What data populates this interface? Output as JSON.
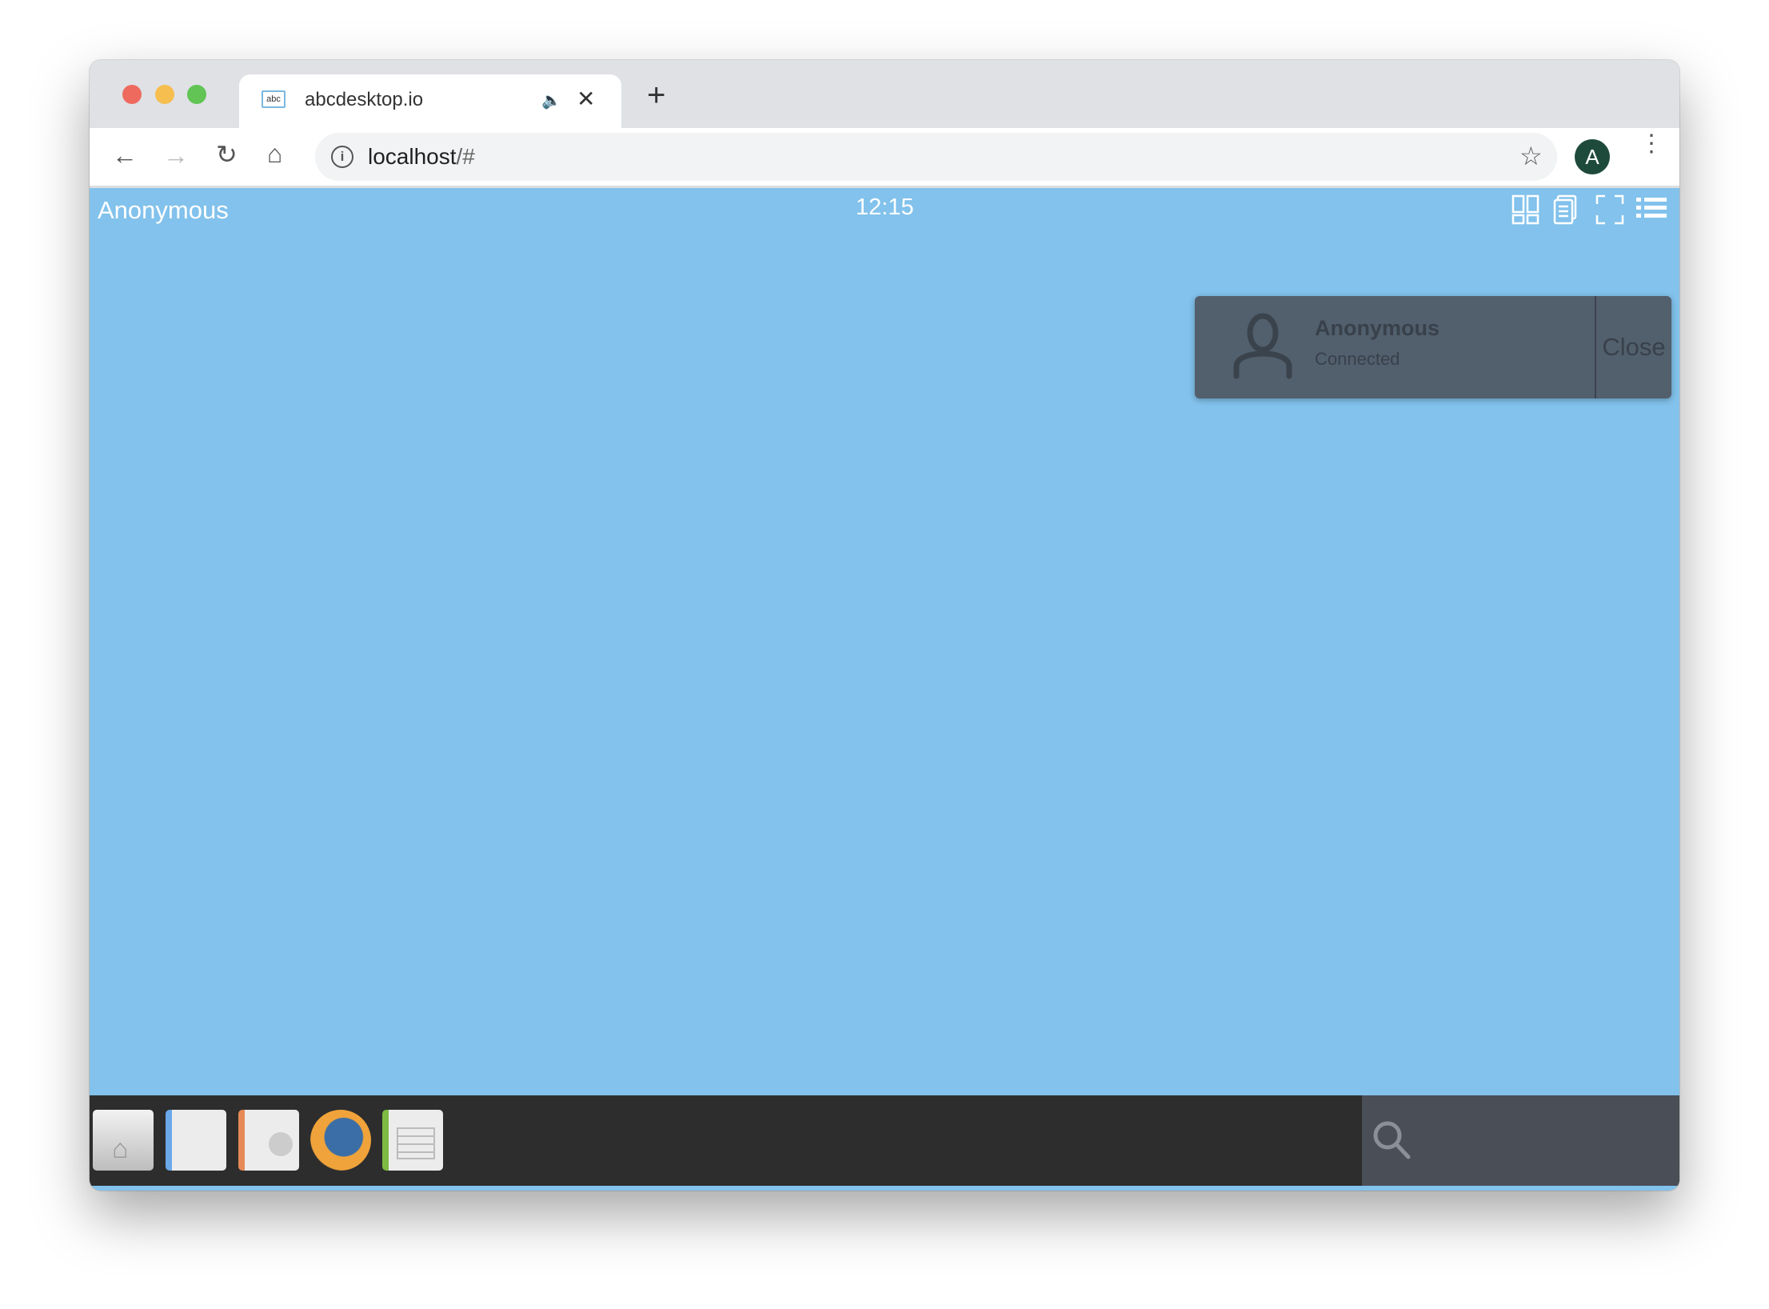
{
  "browser": {
    "tab_title": "abcdesktop.io",
    "favicon_text": "abc",
    "url_host": "localhost",
    "url_path": "/#",
    "profile_initial": "A"
  },
  "desktop": {
    "user": "Anonymous",
    "clock": "12:15"
  },
  "notification": {
    "name": "Anonymous",
    "status": "Connected",
    "close_label": "Close"
  },
  "dock": {
    "apps": [
      "home-folder",
      "writer",
      "impress",
      "firefox",
      "calc"
    ]
  },
  "colors": {
    "desktop_bg": "#82c2ec",
    "dock_bg": "#2d2d2d",
    "notification_bg": "#525f6c",
    "profile": "#1e4a3c"
  }
}
